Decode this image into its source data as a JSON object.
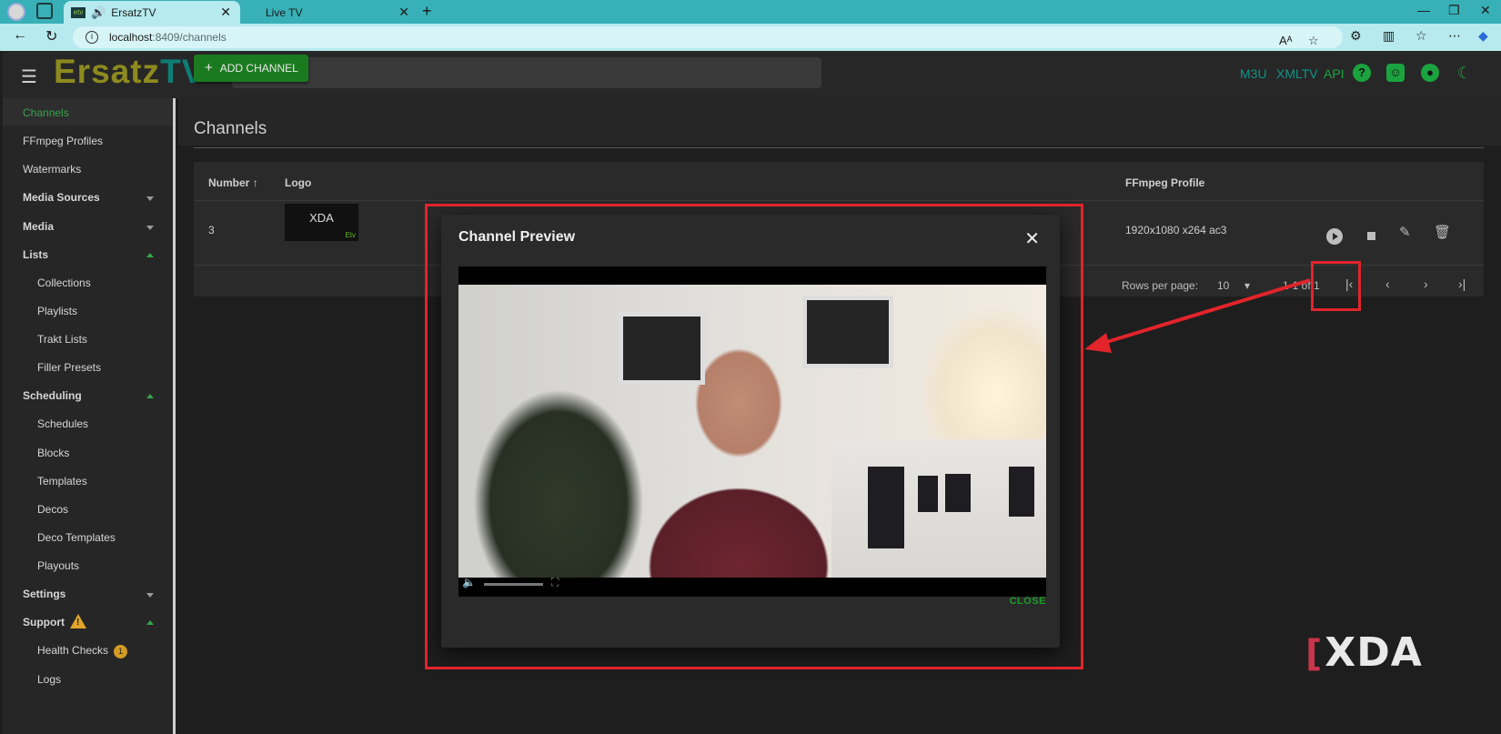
{
  "browser": {
    "tabs": [
      {
        "title": "ErsatzTV",
        "active": true
      },
      {
        "title": "Live TV",
        "active": false
      }
    ],
    "url_host": "localhost",
    "url_path": ":8409/channels",
    "icons": [
      "profile-icon",
      "tab-actions-icon",
      "speaker-icon",
      "close-icon",
      "new-tab-icon",
      "back-icon",
      "refresh-icon",
      "info-icon",
      "read-aloud-icon",
      "favorite-icon",
      "extensions-icon",
      "split-screen-icon",
      "favorites-list-icon",
      "more-icon",
      "copilot-icon"
    ]
  },
  "app": {
    "logo_part1": "Ersatz",
    "logo_part2": "TV",
    "top_links": {
      "m3u": "M3U",
      "xmltv": "XMLTV",
      "api": "API"
    },
    "icons": [
      "menu-icon",
      "search-icon",
      "help-icon",
      "discord-icon",
      "github-icon",
      "dark-mode-icon"
    ],
    "accent_color": "#1aa33f"
  },
  "sidebar": {
    "items": [
      {
        "label": "Channels"
      },
      {
        "label": "FFmpeg Profiles"
      },
      {
        "label": "Watermarks"
      },
      {
        "label": "Media Sources"
      },
      {
        "label": "Media"
      },
      {
        "label": "Lists"
      },
      {
        "label": "Collections"
      },
      {
        "label": "Playlists"
      },
      {
        "label": "Trakt Lists"
      },
      {
        "label": "Filler Presets"
      },
      {
        "label": "Scheduling"
      },
      {
        "label": "Schedules"
      },
      {
        "label": "Blocks"
      },
      {
        "label": "Templates"
      },
      {
        "label": "Decos"
      },
      {
        "label": "Deco Templates"
      },
      {
        "label": "Playouts"
      },
      {
        "label": "Settings"
      },
      {
        "label": "Support"
      },
      {
        "label": "Health Checks"
      },
      {
        "label": "Logs"
      }
    ],
    "health_badge": "1"
  },
  "main": {
    "add_button": "ADD CHANNEL",
    "title": "Channels",
    "columns": {
      "number": "Number",
      "logo": "Logo",
      "ffmpeg": "FFmpeg Profile"
    },
    "row": {
      "number": "3",
      "logo_text": "XDA",
      "logo_small": "Etv",
      "ffmpeg": "1920x1080 x264 ac3"
    },
    "rows_per_page_label": "Rows per page:",
    "rows_per_page": "10",
    "range": "1-1 of 1"
  },
  "dialog": {
    "title": "Channel Preview",
    "close_label": "CLOSE"
  },
  "watermark": "XDA"
}
